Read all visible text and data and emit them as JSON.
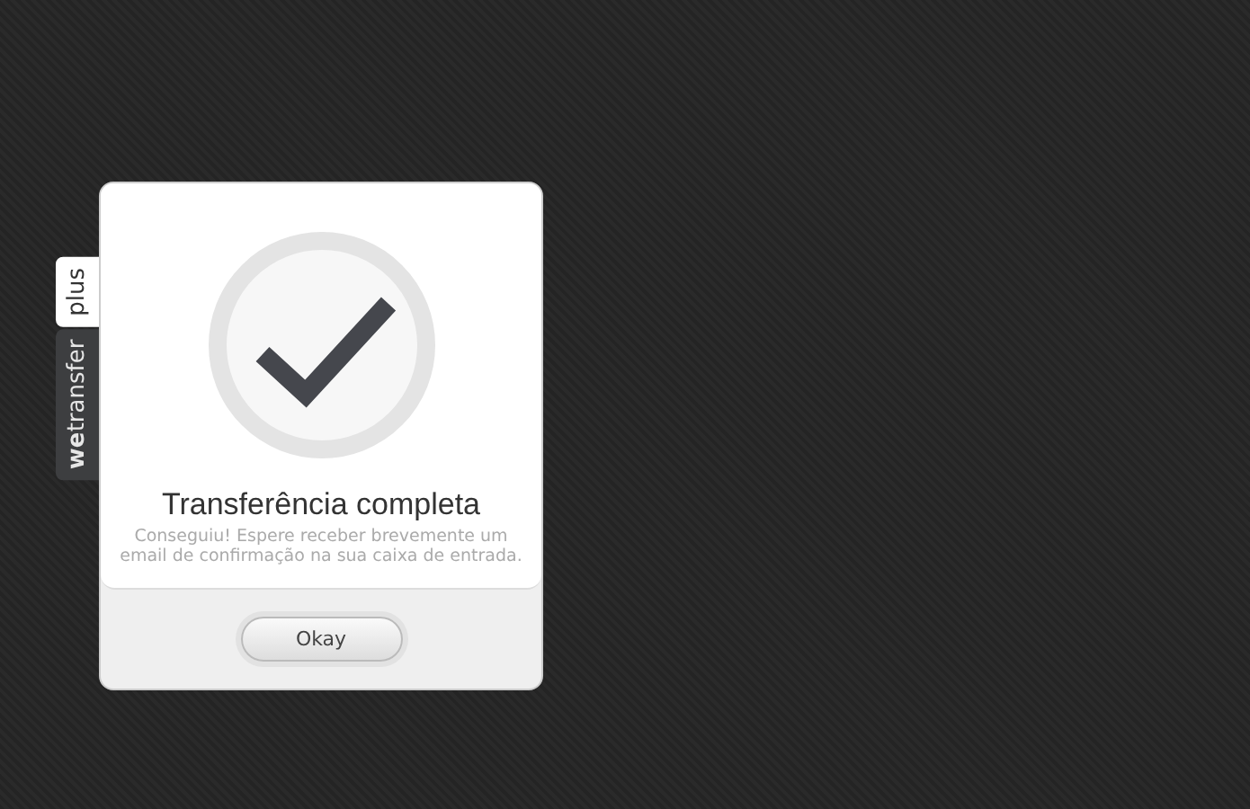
{
  "side_tabs": [
    {
      "label": "plus",
      "selected": true
    },
    {
      "label": "**we**transfer",
      "selected": false
    }
  ],
  "dialog": {
    "title": "Transferência completa",
    "message": "Conseguiu! Espere receber brevemente um email de confirmação na sua caixa de entrada.",
    "button": "Okay"
  }
}
